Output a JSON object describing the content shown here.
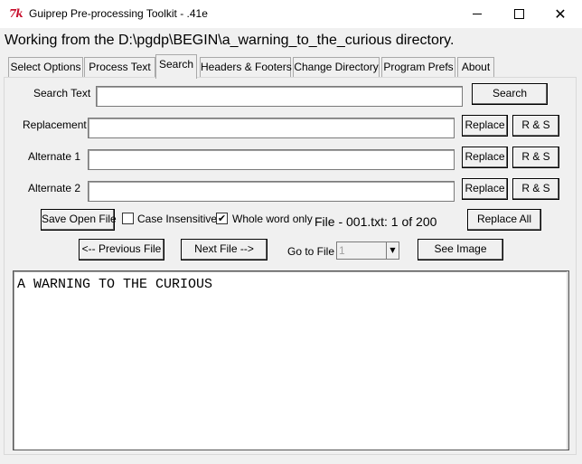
{
  "window": {
    "title": "Guiprep Pre-processing Toolkit - .41e",
    "icon": "tk-feather-icon",
    "minimize": "minimize-icon",
    "maximize": "maximize-icon",
    "close": "close-icon",
    "close_glyph": "✕"
  },
  "working_dir": "Working from the D:\\pgdp\\BEGIN\\a_warning_to_the_curious directory.",
  "tabs": [
    {
      "label": "Select Options",
      "active": false
    },
    {
      "label": "Process Text",
      "active": false
    },
    {
      "label": "Search",
      "active": true
    },
    {
      "label": "Headers & Footers",
      "active": false
    },
    {
      "label": "Change Directory",
      "active": false
    },
    {
      "label": "Program Prefs",
      "active": false
    },
    {
      "label": "About",
      "active": false
    }
  ],
  "search": {
    "search_label": "Search Text",
    "search_value": "",
    "search_button": "Search",
    "replacement_label": "Replacement",
    "replacement_value": "",
    "alternate1_label": "Alternate 1",
    "alternate1_value": "",
    "alternate2_label": "Alternate 2",
    "alternate2_value": "",
    "replace_button": "Replace",
    "rs_button": "R & S",
    "save_open_file": "Save Open File",
    "case_insensitive_label": "Case Insensitive",
    "case_insensitive_checked": false,
    "whole_word_label": "Whole word only",
    "whole_word_checked": true,
    "check_mark": "✔",
    "file_status": "File - 001.txt: 1 of 200",
    "replace_all": "Replace All",
    "previous_file": "<-- Previous File",
    "next_file": "Next File -->",
    "goto_label": "Go to File -",
    "goto_value": "1",
    "goto_arrow": "▼",
    "see_image": "See Image"
  },
  "text_area": {
    "content": "A WARNING TO THE CURIOUS"
  },
  "colors": {
    "window_bg": "#f0f0f0",
    "titlebar_bg": "#ffffff",
    "icon_red": "#c8102e"
  }
}
